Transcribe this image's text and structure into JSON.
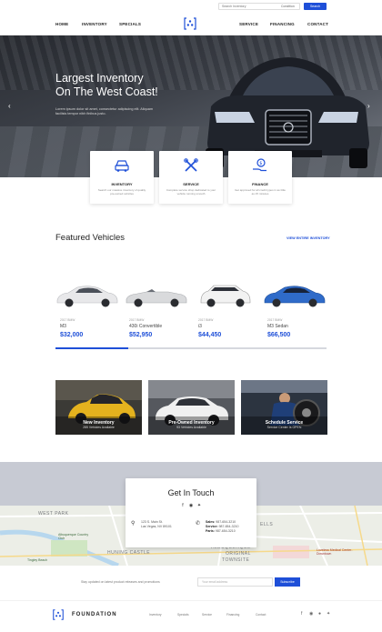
{
  "topbar": {
    "search_placeholder": "Search Inventory",
    "condition": "Condition",
    "search_button": "Search"
  },
  "nav": {
    "left": [
      "HOME",
      "INVENTORY",
      "SPECIALS"
    ],
    "right": [
      "SERVICE",
      "FINANCING",
      "CONTACT"
    ]
  },
  "hero": {
    "title_line1": "Largest Inventory",
    "title_line2": "On The West Coast!",
    "text": "Lorem ipsum dolor sit amet, consectetur adipiscing elit. Aliquam facilisis tempor nibh finibus justo."
  },
  "services": [
    {
      "title": "INVENTORY",
      "desc": "Search our massive inventory of quality pre-owned vehicles",
      "icon": "car-icon"
    },
    {
      "title": "SERVICE",
      "desc": "Complete service shop dedicated to your vehicle running smooth",
      "icon": "tools-icon"
    },
    {
      "title": "FINANCE",
      "desc": "Get approved for all credit types in as little as 15 minutes",
      "icon": "money-hand-icon"
    }
  ],
  "featured": {
    "title": "Featured Vehicles",
    "link": "VIEW ENTIRE INVENTORY",
    "progress": 0.27,
    "vehicles": [
      {
        "make": "2017 BMW",
        "model": "M3",
        "price": "$32,000",
        "color": "#e8e8ea"
      },
      {
        "make": "2017 BMW",
        "model": "430i Convertible",
        "price": "$52,950",
        "color": "#d9dadc"
      },
      {
        "make": "2017 BMW",
        "model": "i3",
        "price": "$44,450",
        "color": "#f2f2f2"
      },
      {
        "make": "2017 BMW",
        "model": "M3 Sedan",
        "price": "$66,500",
        "color": "#2f6bc9"
      }
    ]
  },
  "tiles": [
    {
      "title": "New Inventory",
      "sub": "285 Vehicles Available"
    },
    {
      "title": "Pre-Owned Inventory",
      "sub": "93 Vehicles Available"
    },
    {
      "title": "Schedule Service",
      "sub": "Service Center Is OPEN"
    }
  ],
  "contact": {
    "title": "Get In Touch",
    "address_line1": "123 S. Main St.",
    "address_line2": "Las Vegas, NV 89101",
    "sales_label": "Sales:",
    "sales": "987-654-3210",
    "service_label": "Service:",
    "service": "987-654-3210",
    "parts_label": "Parts:",
    "parts": "987-654-3210"
  },
  "map": {
    "labels": [
      "WEST PARK",
      "HUNING CASTLE",
      "ALBUQUERQUE",
      "ORIGINAL",
      "TOWNSITE",
      "ELLS"
    ],
    "places": [
      "Albuquerque Country Club",
      "Loveless Medical Center-Downtown",
      "Tingley Beach"
    ]
  },
  "newsletter": {
    "text": "Stay updated on latest product releases and promotions",
    "placeholder": "Your email address",
    "button": "Subscribe"
  },
  "footer": {
    "brand": "FOUNDATION",
    "links": [
      "Inventory",
      "Specials",
      "Service",
      "Financing",
      "Contact"
    ]
  },
  "colors": {
    "accent": "#1e4fd8",
    "band": "#c7cad3"
  }
}
